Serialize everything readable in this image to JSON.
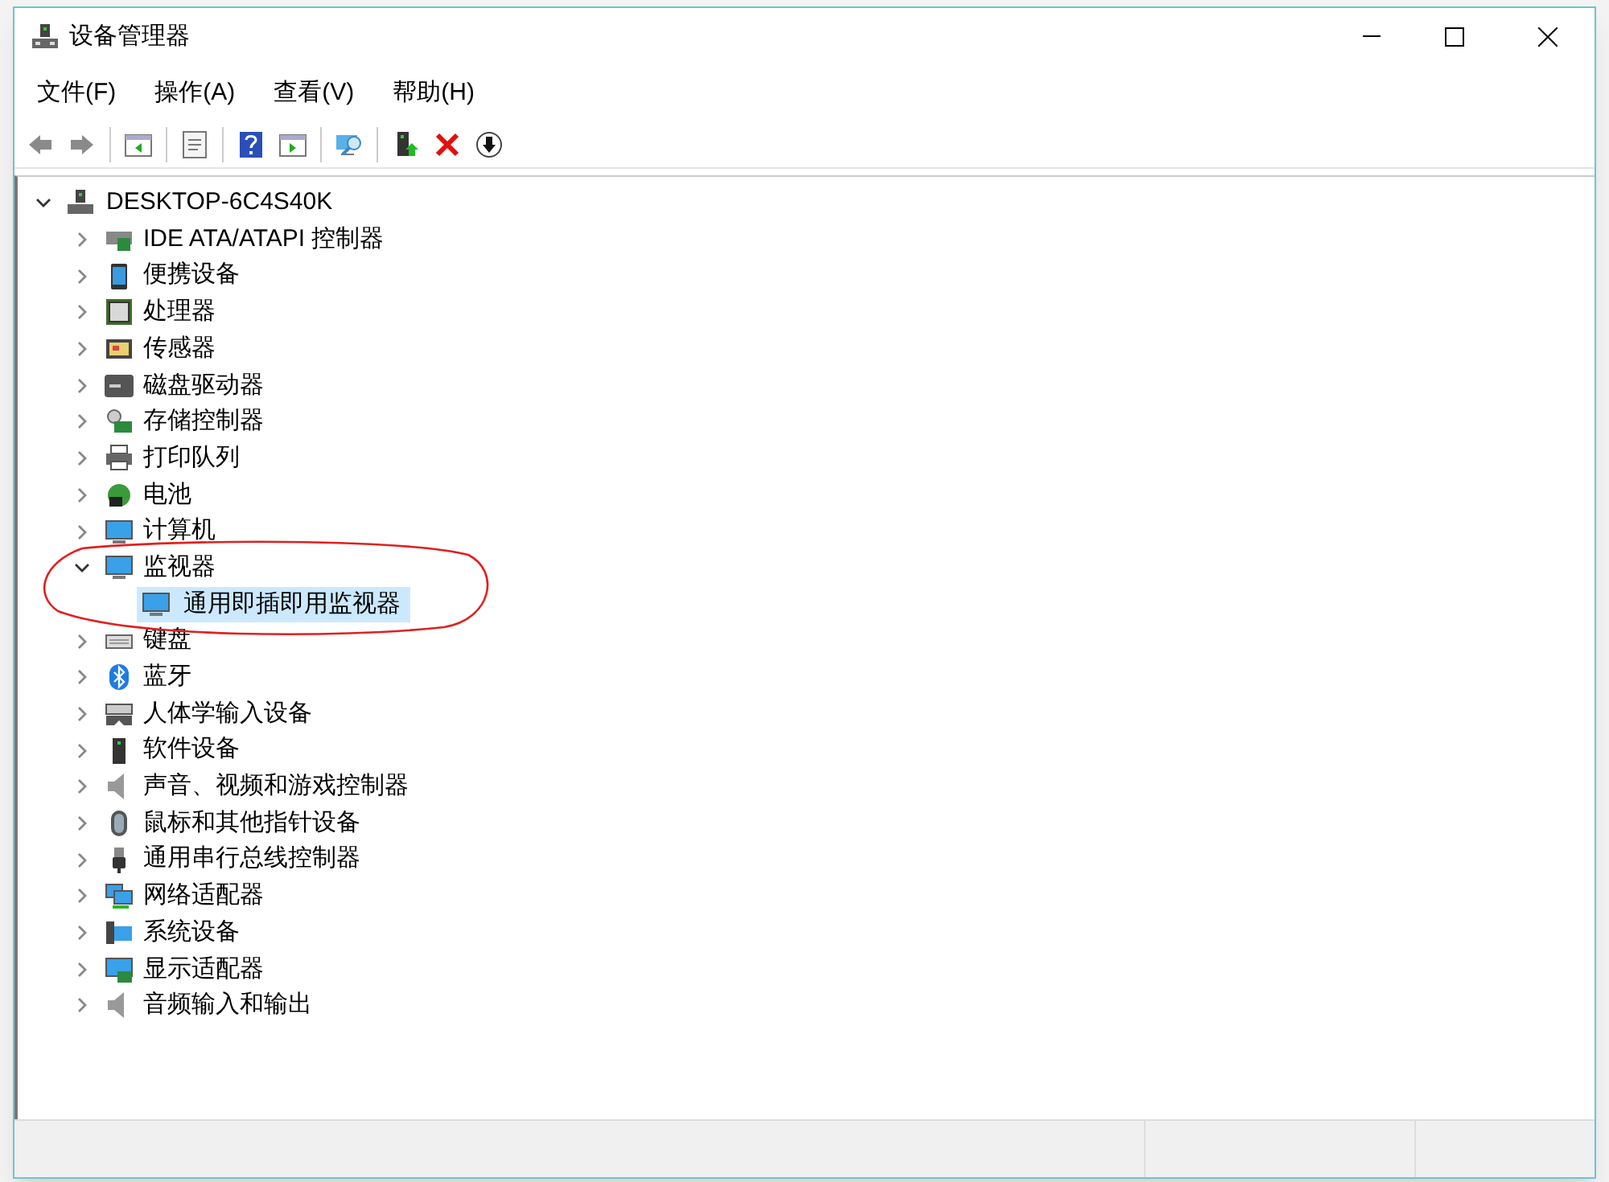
{
  "window": {
    "title": "设备管理器"
  },
  "menu": [
    "文件(F)",
    "操作(A)",
    "查看(V)",
    "帮助(H)"
  ],
  "tree": {
    "label": "DESKTOP-6C4S40K",
    "expanded": true,
    "children": [
      {
        "label": "IDE ATA/ATAPI 控制器",
        "expanded": false
      },
      {
        "label": "便携设备",
        "expanded": false
      },
      {
        "label": "处理器",
        "expanded": false
      },
      {
        "label": "传感器",
        "expanded": false
      },
      {
        "label": "磁盘驱动器",
        "expanded": false
      },
      {
        "label": "存储控制器",
        "expanded": false
      },
      {
        "label": "打印队列",
        "expanded": false
      },
      {
        "label": "电池",
        "expanded": false
      },
      {
        "label": "计算机",
        "expanded": false
      },
      {
        "label": "监视器",
        "expanded": true,
        "children": [
          {
            "label": "通用即插即用监视器",
            "selected": true
          }
        ]
      },
      {
        "label": "键盘",
        "expanded": false
      },
      {
        "label": "蓝牙",
        "expanded": false
      },
      {
        "label": "人体学输入设备",
        "expanded": false
      },
      {
        "label": "软件设备",
        "expanded": false
      },
      {
        "label": "声音、视频和游戏控制器",
        "expanded": false
      },
      {
        "label": "鼠标和其他指针设备",
        "expanded": false
      },
      {
        "label": "通用串行总线控制器",
        "expanded": false
      },
      {
        "label": "网络适配器",
        "expanded": false
      },
      {
        "label": "系统设备",
        "expanded": false
      },
      {
        "label": "显示适配器",
        "expanded": false
      },
      {
        "label": "音频输入和输出",
        "expanded": false
      }
    ]
  }
}
